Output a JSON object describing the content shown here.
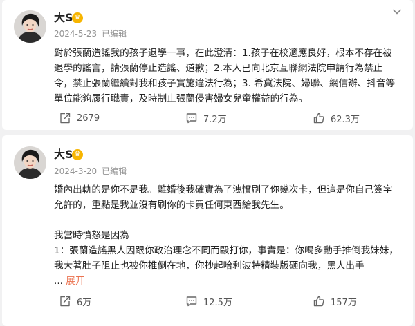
{
  "posts": [
    {
      "author": "大S",
      "badge": "♛",
      "date": "2024-5-23",
      "edited": "已编辑",
      "paragraphs": [
        "對於張蘭造謠我的孩子退學一事，在此澄清：1.孩子在校適應良好，根本不存在被退學的謠言，請張蘭停止造謠、道歉；2.本人已向北京互聯網法院申請行為禁止令，禁止張蘭繼續對我和孩子實施違法行為；3. 希冀法院、婦聯、網信辦、抖音等單位能夠履行職責，及時制止張蘭侵害婦女兒童權益的行為。"
      ],
      "reposts": "2679",
      "comments": "7.2万",
      "likes": "62.3万"
    },
    {
      "author": "大S",
      "badge": "♛",
      "date": "2024-3-20",
      "edited": "已编辑",
      "paragraphs": [
        "婚內出軌的是你不是我。離婚後我確實為了洩憤刷了你幾次卡，但這是你自己簽字允許的，重點是我並沒有刷你的卡買任何東西給我先生。",
        "我當時憤怒是因為",
        "1：張蘭造謠黑人因跟你政治理念不同而毆打你，事實是：你喝多動手推倒我妹妹，我大著肚子阻止也被你推倒在地，你抄起哈利波特精裝版砸向我，黑人出手"
      ],
      "ellipsis": "...",
      "expand": "展开",
      "reposts": "6万",
      "comments": "12.5万",
      "likes": "157万"
    }
  ]
}
